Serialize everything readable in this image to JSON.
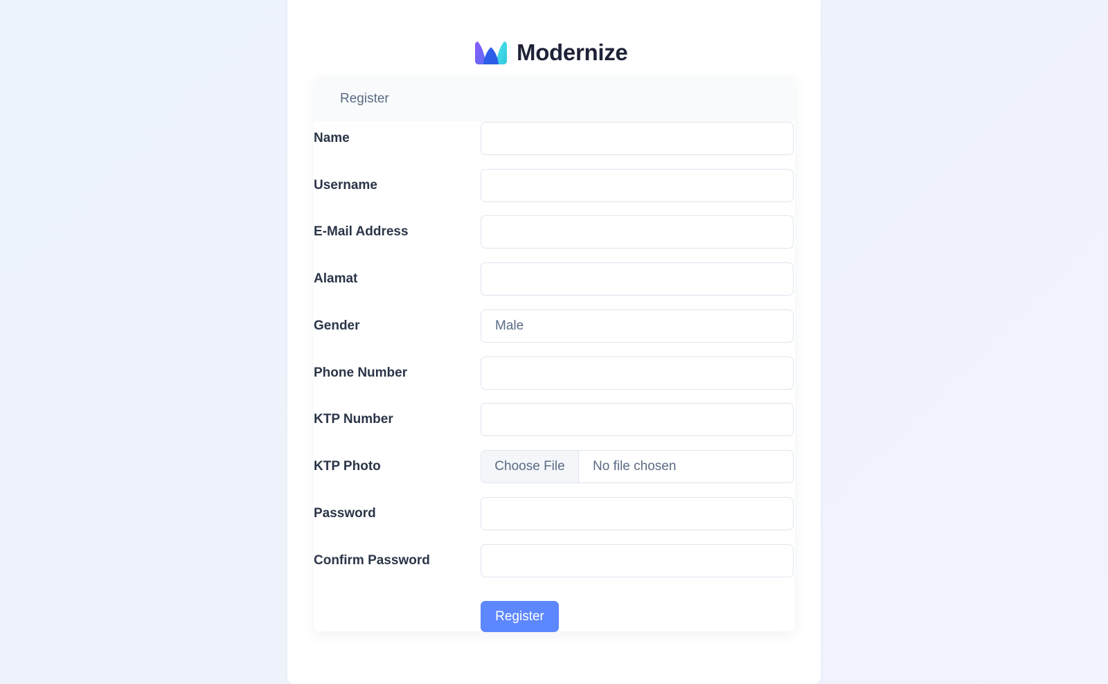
{
  "brand": {
    "name": "Modernize",
    "colors": [
      "#7c5cfc",
      "#2b6ff2",
      "#3ddbe6"
    ]
  },
  "form": {
    "title": "Register",
    "fields": {
      "name": {
        "label": "Name",
        "value": ""
      },
      "username": {
        "label": "Username",
        "value": ""
      },
      "email": {
        "label": "E-Mail Address",
        "value": ""
      },
      "alamat": {
        "label": "Alamat",
        "value": ""
      },
      "gender": {
        "label": "Gender",
        "value": "Male"
      },
      "phone": {
        "label": "Phone Number",
        "value": ""
      },
      "ktp_number": {
        "label": "KTP Number",
        "value": ""
      },
      "ktp_photo": {
        "label": "KTP Photo",
        "button": "Choose File",
        "status": "No file chosen"
      },
      "password": {
        "label": "Password",
        "value": ""
      },
      "confirm_password": {
        "label": "Confirm Password",
        "value": ""
      }
    },
    "submit_label": "Register",
    "accent": "#5d87ff"
  }
}
